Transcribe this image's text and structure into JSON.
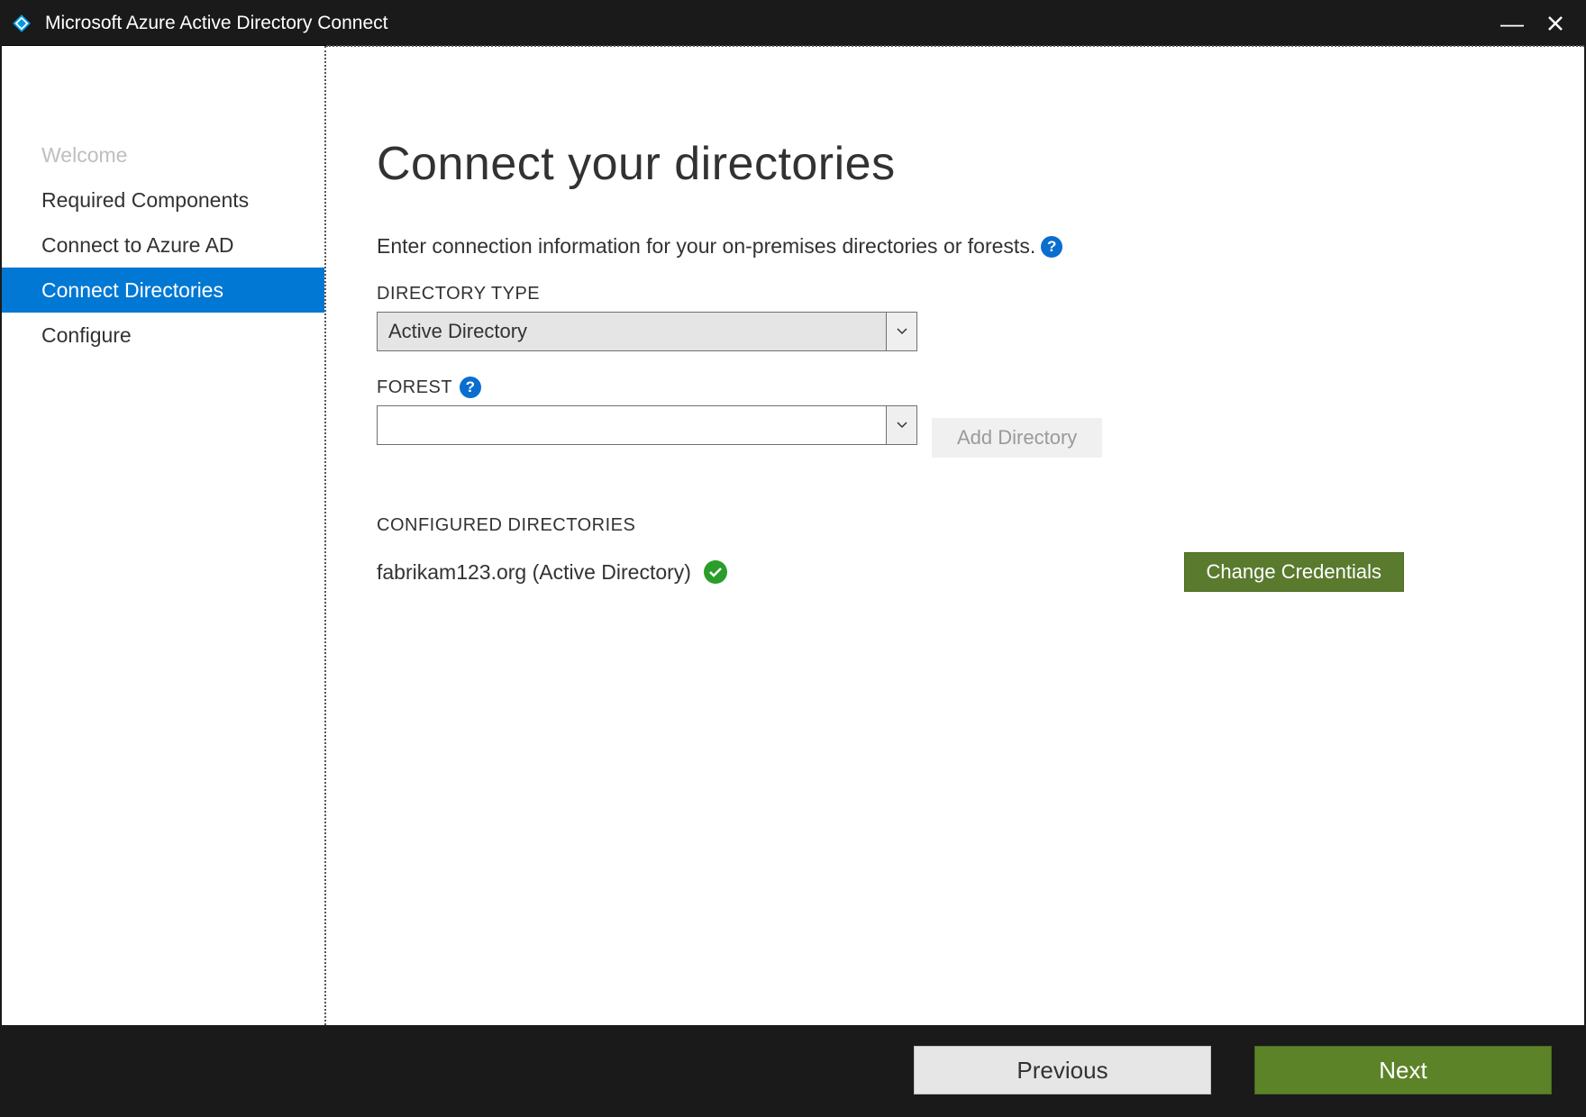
{
  "titlebar": {
    "title": "Microsoft Azure Active Directory Connect"
  },
  "sidebar": {
    "items": [
      {
        "label": "Welcome"
      },
      {
        "label": "Required Components"
      },
      {
        "label": "Connect to Azure AD"
      },
      {
        "label": "Connect Directories"
      },
      {
        "label": "Configure"
      }
    ]
  },
  "main": {
    "heading": "Connect your directories",
    "instruction": "Enter connection information for your on-premises directories or forests.",
    "directory_type_label": "DIRECTORY TYPE",
    "directory_type_value": "Active Directory",
    "forest_label": "FOREST",
    "forest_value": "",
    "add_directory_label": "Add Directory",
    "configured_label": "CONFIGURED DIRECTORIES",
    "configured_entry": "fabrikam123.org (Active Directory)",
    "change_credentials_label": "Change Credentials"
  },
  "footer": {
    "previous": "Previous",
    "next": "Next"
  }
}
